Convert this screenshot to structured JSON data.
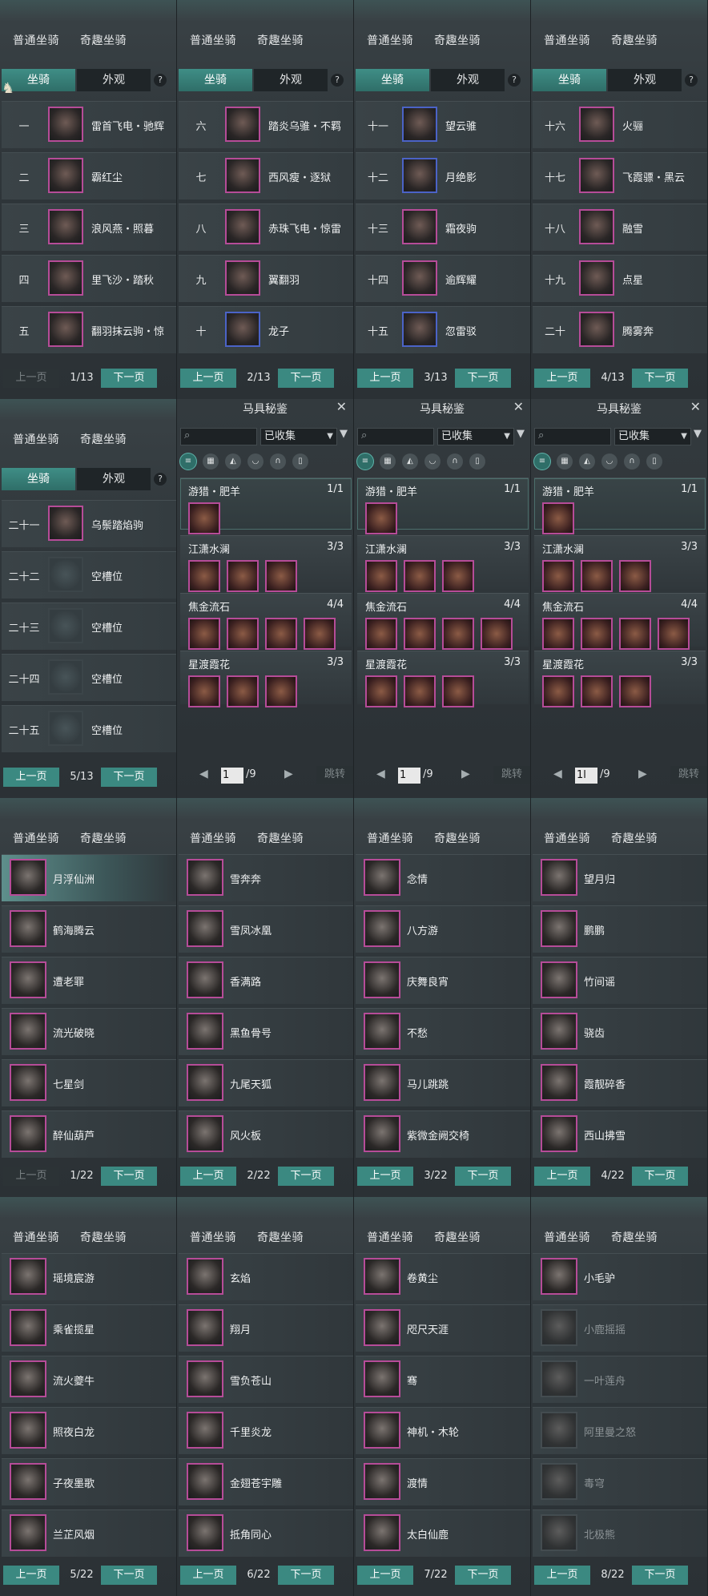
{
  "tabs": {
    "normal": "普通坐骑",
    "fun": "奇趣坐骑"
  },
  "subtabs": {
    "mount": "坐骑",
    "look": "外观",
    "help": "?"
  },
  "pager": {
    "prev": "上一页",
    "next": "下一页"
  },
  "saddle": {
    "title": "马具秘鉴",
    "close": "✕",
    "filter": "已收集",
    "jump": "跳转",
    "page_total": "/9",
    "sets": [
      {
        "name": "游猎・肥羊",
        "count": "1/1",
        "items": 1
      },
      {
        "name": "江潇水澜",
        "count": "3/3",
        "items": 3
      },
      {
        "name": "焦金流石",
        "count": "4/4",
        "items": 4
      },
      {
        "name": "星渡霞花",
        "count": "3/3",
        "items": 3
      }
    ],
    "pages": [
      "1",
      "1",
      "1l"
    ]
  },
  "mount_pages": [
    {
      "page": "1/13",
      "prev_disabled": true,
      "rows": [
        {
          "num": "一",
          "name": "雷首飞电・驰辉",
          "blue": false
        },
        {
          "num": "二",
          "name": "霸红尘",
          "blue": false
        },
        {
          "num": "三",
          "name": "浪风燕・照暮",
          "blue": false
        },
        {
          "num": "四",
          "name": "里飞沙・踏秋",
          "blue": false
        },
        {
          "num": "五",
          "name": "翻羽抹云驹・惊",
          "blue": false
        }
      ]
    },
    {
      "page": "2/13",
      "prev_disabled": false,
      "rows": [
        {
          "num": "六",
          "name": "踏炎乌骓・不羁",
          "blue": false
        },
        {
          "num": "七",
          "name": "西风瘦・逐狱",
          "blue": false
        },
        {
          "num": "八",
          "name": "赤珠飞电・惊雷",
          "blue": false
        },
        {
          "num": "九",
          "name": "翼翻羽",
          "blue": false
        },
        {
          "num": "十",
          "name": "龙子",
          "blue": true
        }
      ]
    },
    {
      "page": "3/13",
      "prev_disabled": false,
      "rows": [
        {
          "num": "十一",
          "name": "望云骓",
          "blue": true
        },
        {
          "num": "十二",
          "name": "月绝影",
          "blue": true
        },
        {
          "num": "十三",
          "name": "霜夜驹",
          "blue": false
        },
        {
          "num": "十四",
          "name": "逾辉耀",
          "blue": false
        },
        {
          "num": "十五",
          "name": "忽雷驳",
          "blue": true
        }
      ]
    },
    {
      "page": "4/13",
      "prev_disabled": false,
      "rows": [
        {
          "num": "十六",
          "name": "火骊",
          "blue": false
        },
        {
          "num": "十七",
          "name": "飞霞骠・黑云",
          "blue": false
        },
        {
          "num": "十八",
          "name": "融雪",
          "blue": false
        },
        {
          "num": "十九",
          "name": "点星",
          "blue": false
        },
        {
          "num": "二十",
          "name": "腾雾奔",
          "blue": false
        }
      ]
    },
    {
      "page": "5/13",
      "prev_disabled": false,
      "rows": [
        {
          "num": "二十一",
          "name": "乌鬃踏焰驹",
          "blue": false
        },
        {
          "num": "二十二",
          "name": "空槽位",
          "empty": true
        },
        {
          "num": "二十三",
          "name": "空槽位",
          "empty": true
        },
        {
          "num": "二十四",
          "name": "空槽位",
          "empty": true
        },
        {
          "num": "二十五",
          "name": "空槽位",
          "empty": true
        }
      ]
    }
  ],
  "fun_pages": [
    {
      "page": "1/22",
      "prev_disabled": true,
      "rows": [
        "月浮仙洲",
        "鹤海腾云",
        "遭老罪",
        "流光破晓",
        "七星剑",
        "醉仙葫芦"
      ]
    },
    {
      "page": "2/22",
      "prev_disabled": false,
      "rows": [
        "雪奔奔",
        "雪凤冰凰",
        "香满路",
        "黑鱼骨号",
        "九尾天狐",
        "风火板"
      ]
    },
    {
      "page": "3/22",
      "prev_disabled": false,
      "rows": [
        "念情",
        "八方游",
        "庆舞良宵",
        "不愁",
        "马儿跳跳",
        "紫微金阙交椅"
      ]
    },
    {
      "page": "4/22",
      "prev_disabled": false,
      "rows": [
        "望月归",
        "鹏鹏",
        "竹间谣",
        "骁齿",
        "霞靓碎香",
        "西山拂雪"
      ]
    },
    {
      "page": "5/22",
      "prev_disabled": false,
      "rows": [
        "瑶境宸游",
        "乘雀揽星",
        "流火夔牛",
        "照夜白龙",
        "子夜墨歌",
        "兰芷风烟"
      ]
    },
    {
      "page": "6/22",
      "prev_disabled": false,
      "rows": [
        "玄焰",
        "翔月",
        "雪负苍山",
        "千里炎龙",
        "金翅苍宇雕",
        "抵角同心"
      ]
    },
    {
      "page": "7/22",
      "prev_disabled": false,
      "rows": [
        "卷黄尘",
        "咫尺天涯",
        "骞",
        "神机・木轮",
        "渡情",
        "太白仙鹿"
      ]
    },
    {
      "page": "8/22",
      "prev_disabled": false,
      "rows": [
        "小毛驴",
        "小鹿摇摇",
        "一叶莲舟",
        "阿里曼之怒",
        "毒穹",
        "北极熊"
      ],
      "gray_from": 1
    }
  ],
  "colors": {
    "accent": "#3b8981",
    "rare_border": "#b64c98",
    "epic_border": "#4b63c7"
  }
}
